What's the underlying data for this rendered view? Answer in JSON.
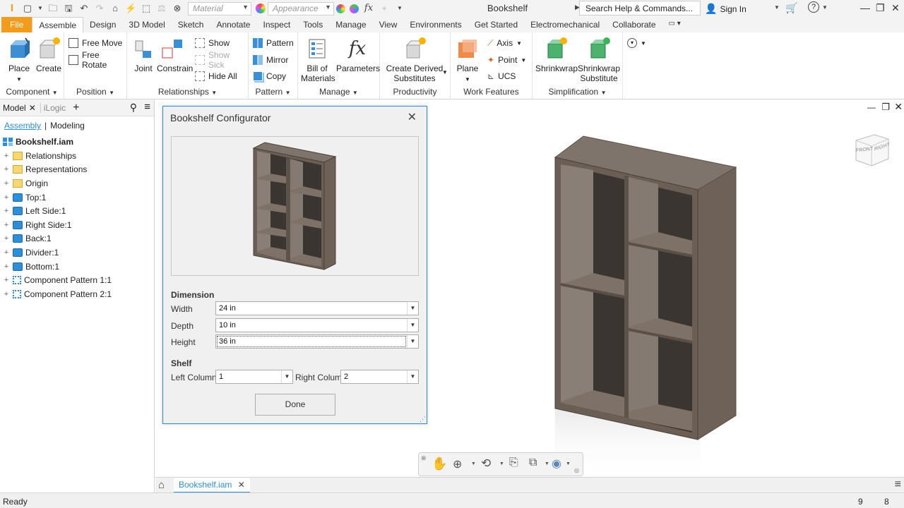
{
  "app": {
    "title": "Bookshelf",
    "search_placeholder": "Search Help & Commands...",
    "sign_in": "Sign In"
  },
  "quick_access": {
    "material": "Material",
    "appearance": "Appearance"
  },
  "tabs": [
    "File",
    "Assemble",
    "Design",
    "3D Model",
    "Sketch",
    "Annotate",
    "Inspect",
    "Tools",
    "Manage",
    "View",
    "Environments",
    "Get Started",
    "Electromechanical",
    "Collaborate"
  ],
  "active_tab": "Assemble",
  "ribbon": {
    "component": {
      "label": "Component",
      "place": "Place",
      "create": "Create"
    },
    "position": {
      "label": "Position",
      "free_move": "Free Move",
      "free_rotate": "Free Rotate"
    },
    "relationships": {
      "label": "Relationships",
      "joint": "Joint",
      "constrain": "Constrain",
      "show": "Show",
      "show_sick": "Show Sick",
      "hide_all": "Hide All"
    },
    "pattern": {
      "label": "Pattern",
      "pattern": "Pattern",
      "mirror": "Mirror",
      "copy": "Copy"
    },
    "manage": {
      "label": "Manage",
      "bom_1": "Bill of",
      "bom_2": "Materials",
      "parameters": "Parameters"
    },
    "productivity": {
      "label": "Productivity",
      "derived_1": "Create Derived",
      "derived_2": "Substitutes"
    },
    "work_features": {
      "label": "Work Features",
      "plane": "Plane",
      "axis": "Axis",
      "point": "Point",
      "ucs": "UCS"
    },
    "simplification": {
      "label": "Simplification",
      "shrinkwrap": "Shrinkwrap",
      "substitute_1": "Shrinkwrap",
      "substitute_2": "Substitute"
    }
  },
  "browser": {
    "tab_model": "Model",
    "tab_ilogic": "iLogic",
    "assembly": "Assembly",
    "modeling": "Modeling",
    "root": "Bookshelf.iam",
    "items": [
      {
        "label": "Relationships",
        "icon": "folder-icon"
      },
      {
        "label": "Representations",
        "icon": "representations-icon"
      },
      {
        "label": "Origin",
        "icon": "folder-icon"
      },
      {
        "label": "Top:1",
        "icon": "part-icon"
      },
      {
        "label": "Left Side:1",
        "icon": "part-icon"
      },
      {
        "label": "Right Side:1",
        "icon": "part-icon"
      },
      {
        "label": "Back:1",
        "icon": "part-icon"
      },
      {
        "label": "Divider:1",
        "icon": "part-icon"
      },
      {
        "label": "Bottom:1",
        "icon": "part-icon"
      },
      {
        "label": "Component Pattern 1:1",
        "icon": "pattern-icon"
      },
      {
        "label": "Component Pattern 2:1",
        "icon": "pattern-icon"
      }
    ]
  },
  "dialog": {
    "title": "Bookshelf Configurator",
    "dimension_heading": "Dimension",
    "width_label": "Width",
    "width_value": "24 in",
    "depth_label": "Depth",
    "depth_value": "10 in",
    "height_label": "Height",
    "height_value": "36 in",
    "shelf_heading": "Shelf",
    "left_column_label": "Left Column",
    "left_column_value": "1",
    "right_column_label": "Right Column",
    "right_column_value": "2",
    "done": "Done"
  },
  "viewcube": {
    "front": "FRONT",
    "right": "RIGHT"
  },
  "document_tab": "Bookshelf.iam",
  "status": {
    "text": "Ready",
    "count_a": "9",
    "count_b": "8"
  },
  "colors": {
    "accent": "#2e8fd6",
    "file_tab": "#f39b1a",
    "wood": "#6e6157"
  }
}
